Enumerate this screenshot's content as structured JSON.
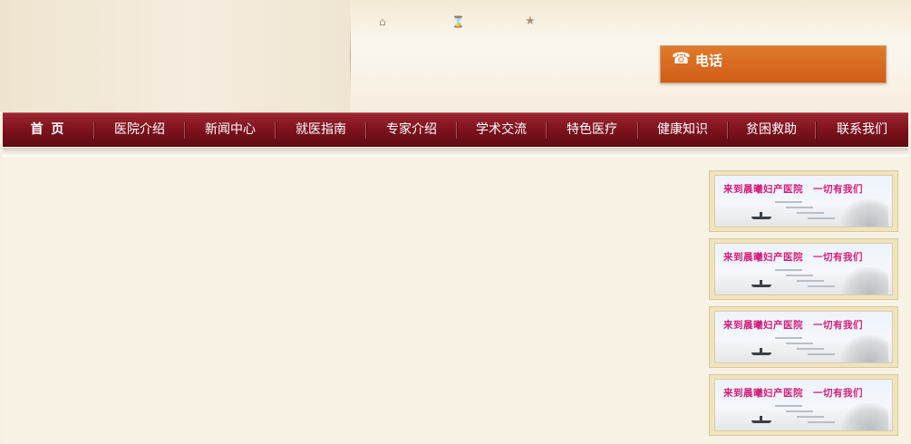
{
  "header": {
    "icons": [
      {
        "name": "home-icon",
        "glyph": "⌂"
      },
      {
        "name": "bookmark-icon",
        "glyph": "⌛"
      },
      {
        "name": "star-icon",
        "glyph": "★"
      }
    ],
    "phone": {
      "icon": "telephone-icon",
      "icon_glyph": "☎",
      "label": "电话",
      "color": "#d4651f"
    }
  },
  "nav": {
    "items": [
      {
        "label": "首 页",
        "active": true
      },
      {
        "label": "医院介绍"
      },
      {
        "label": "新闻中心"
      },
      {
        "label": "就医指南"
      },
      {
        "label": "专家介绍"
      },
      {
        "label": "学术交流"
      },
      {
        "label": "特色医疗"
      },
      {
        "label": "健康知识"
      },
      {
        "label": "贫困救助"
      },
      {
        "label": "联系我们"
      }
    ],
    "color": "#7d121c"
  },
  "banners": [
    {
      "title": "来到晨曦妇产医院　一切有我们"
    },
    {
      "title": "来到晨曦妇产医院　一切有我们"
    },
    {
      "title": "来到晨曦妇产医院　一切有我们"
    },
    {
      "title": "来到晨曦妇产医院　一切有我们"
    }
  ]
}
